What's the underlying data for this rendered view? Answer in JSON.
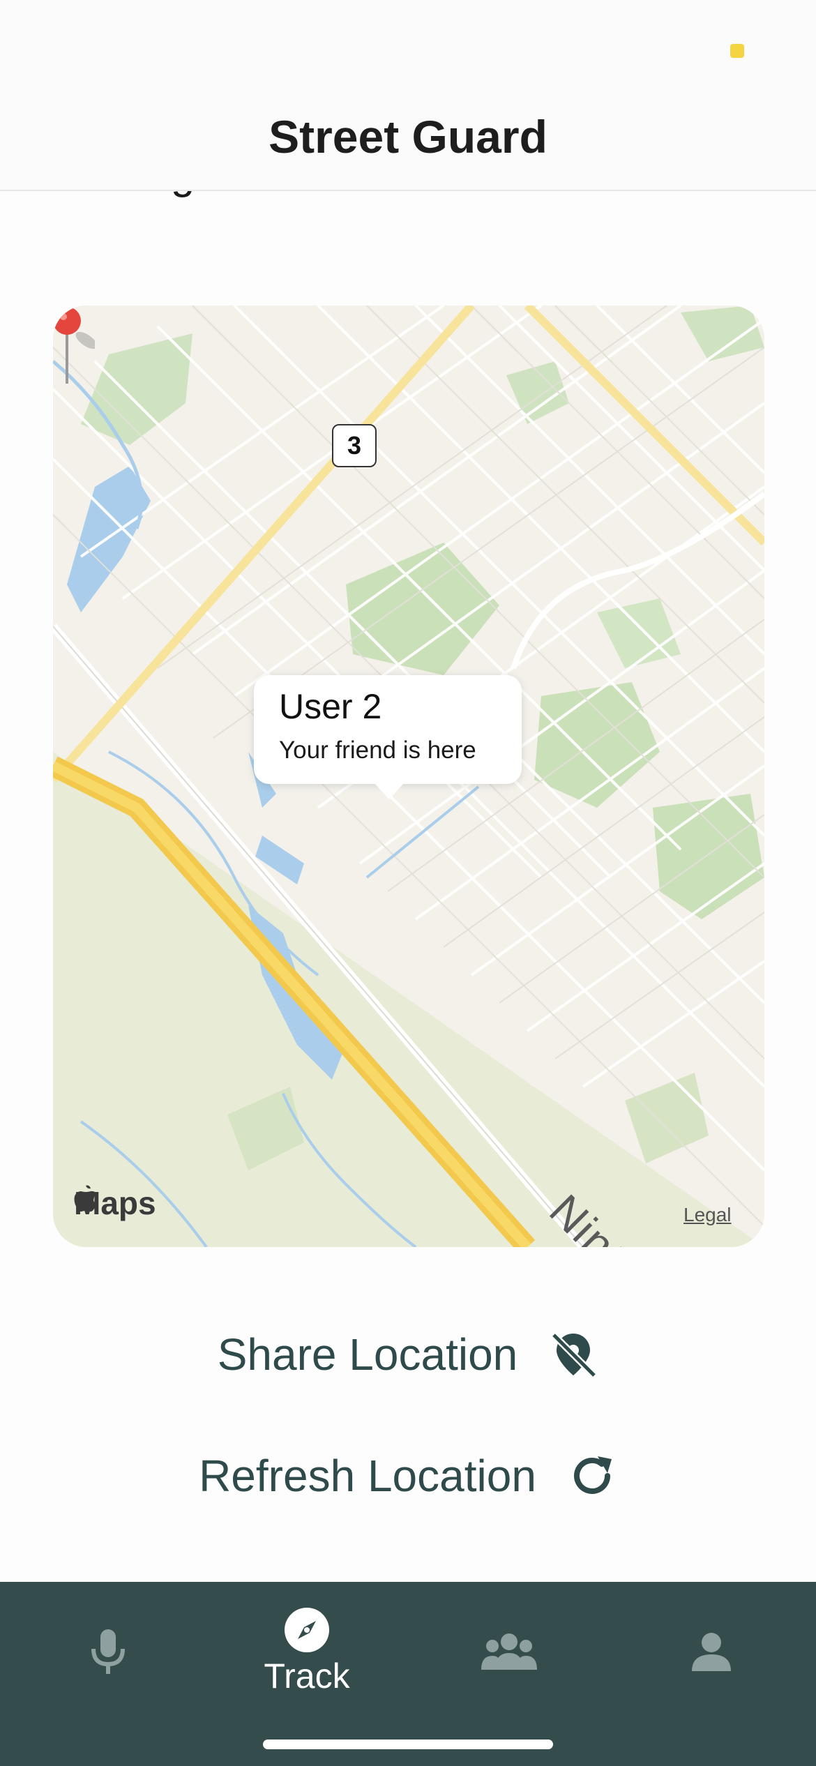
{
  "status_bar": {
    "indicator_color": "#f5d442"
  },
  "header": {
    "title": "Street Guard"
  },
  "intro": {
    "text": "sharing."
  },
  "map": {
    "route_shield": "3",
    "callout": {
      "title": "User 2",
      "subtitle": "Your friend is here"
    },
    "street_label": "Ninth L",
    "attribution": "Maps",
    "legal": "Legal",
    "pin_color": "#e4463d"
  },
  "actions": {
    "share": {
      "label": "Share Location",
      "icon": "location-off-icon"
    },
    "refresh": {
      "label": "Refresh Location",
      "icon": "refresh-icon"
    }
  },
  "tab_bar": {
    "tabs": [
      {
        "label": "",
        "icon": "microphone-icon",
        "active": false
      },
      {
        "label": "Track",
        "icon": "compass-icon",
        "active": true
      },
      {
        "label": "",
        "icon": "group-icon",
        "active": false
      },
      {
        "label": "",
        "icon": "person-icon",
        "active": false
      }
    ],
    "background": "#354c4d"
  },
  "colors": {
    "accent": "#2f4a4a"
  }
}
